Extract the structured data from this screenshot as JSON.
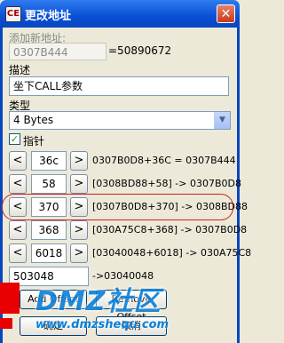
{
  "window": {
    "title": "更改地址",
    "app_icon_text": "CE"
  },
  "form": {
    "add_address_label": "添加新地址:",
    "address_value": "0307B444",
    "address_result": "=50890672",
    "description_label": "描述",
    "description_value": "坐下CALL参数",
    "type_label": "类型",
    "type_value": "4 Bytes",
    "pointer_label": "指针",
    "pointer_checked": true
  },
  "offsets": [
    {
      "value": "36c",
      "text": "0307B0D8+36C = 0307B444"
    },
    {
      "value": "58",
      "text": "[0308BD88+58] -> 0307B0D8"
    },
    {
      "value": "370",
      "text": "[0307B0D8+370] -> 0308BD88"
    },
    {
      "value": "368",
      "text": "[030A75C8+368] -> 0307B0D8"
    },
    {
      "value": "6018",
      "text": "[03040048+6018] -> 030A75C8"
    }
  ],
  "base": {
    "value": "503048",
    "text": "->03040048"
  },
  "buttons": {
    "add_offset": "Add Offset",
    "remove_offset": "Remove Offset",
    "ok": "确定",
    "cancel": "取消"
  },
  "watermark": {
    "logo": "DMZ社区",
    "url": "www.dmzshequ.com"
  },
  "colors": {
    "titlebar": "#0a4fd6",
    "dialog_bg": "#ece9d8",
    "highlight": "#d02020",
    "watermark": "#0a7fd9"
  }
}
